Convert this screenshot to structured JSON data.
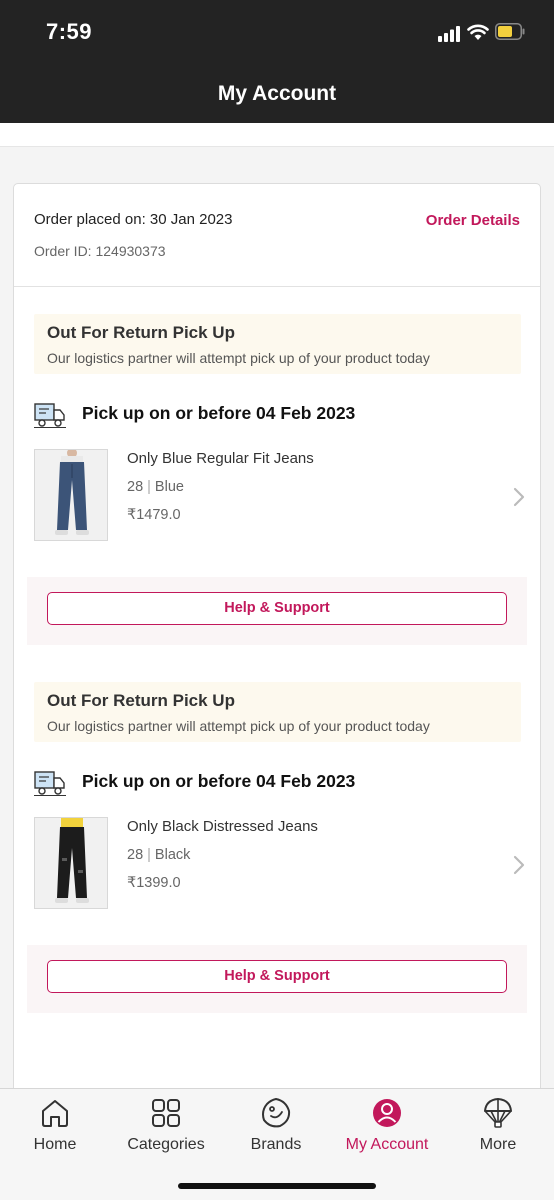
{
  "status_bar": {
    "time": "7:59"
  },
  "header": {
    "title": "My Account"
  },
  "order": {
    "placed_label": "Order placed on: 30 Jan 2023",
    "id_label": "Order ID: 124930373",
    "details_link": "Order Details"
  },
  "items": [
    {
      "status_title": "Out For Return Pick Up",
      "status_sub": "Our logistics partner will attempt pick up of your product today",
      "pickup": "Pick up on or before 04 Feb 2023",
      "name": "Only Blue Regular Fit Jeans",
      "size": "28",
      "color": "Blue",
      "price": "₹1479.0",
      "help": "Help & Support",
      "thumb_color": "#3c5478"
    },
    {
      "status_title": "Out For Return Pick Up",
      "status_sub": "Our logistics partner will attempt pick up of your product today",
      "pickup": "Pick up on or before 04 Feb 2023",
      "name": "Only Black Distressed Jeans",
      "size": "28",
      "color": "Black",
      "price": "₹1399.0",
      "help": "Help & Support",
      "thumb_color": "#1c1c1c"
    }
  ],
  "tabs": [
    {
      "label": "Home",
      "icon": "home-icon"
    },
    {
      "label": "Categories",
      "icon": "categories-icon"
    },
    {
      "label": "Brands",
      "icon": "brands-icon"
    },
    {
      "label": "My Account",
      "icon": "account-icon",
      "active": true
    },
    {
      "label": "More",
      "icon": "more-icon"
    }
  ],
  "colors": {
    "accent": "#c2185b",
    "header_bg": "#232323",
    "status_bg": "#fdf9ee"
  }
}
